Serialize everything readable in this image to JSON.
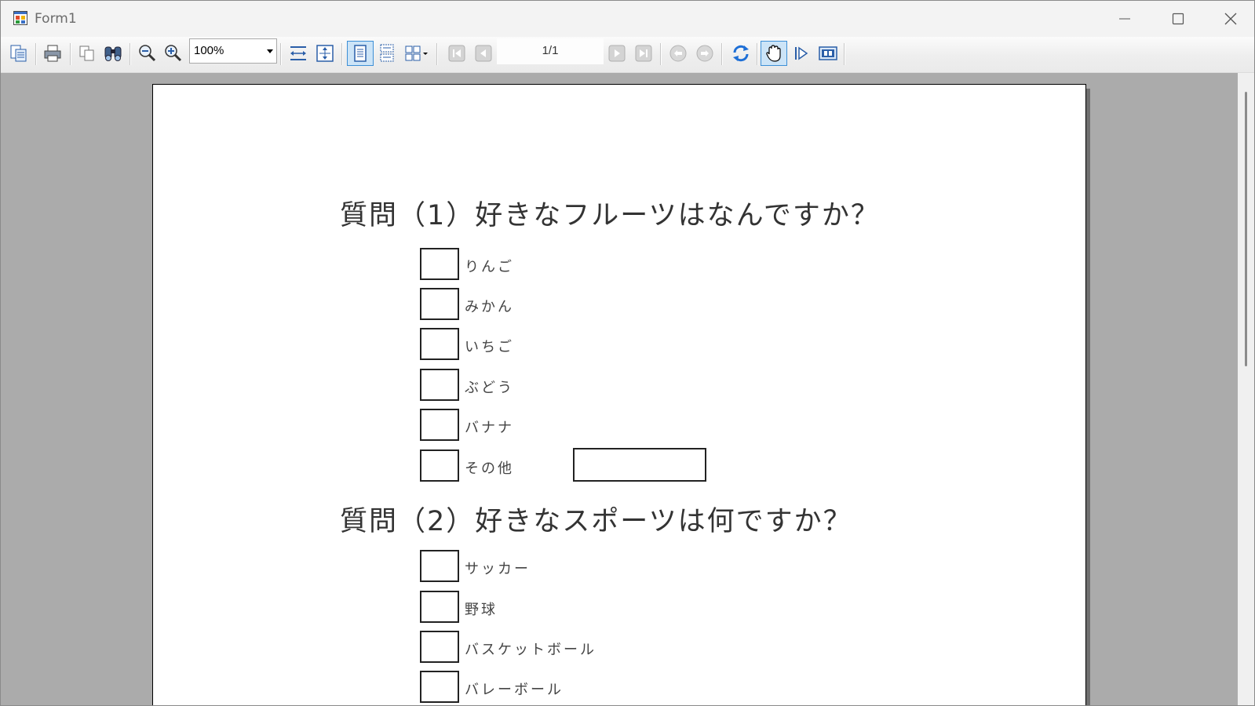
{
  "window": {
    "title": "Form1"
  },
  "toolbar": {
    "zoom_value": "100%",
    "page_indicator": "1/1"
  },
  "icons": {
    "window": [
      "app-icon",
      "minimize-icon",
      "maximize-icon",
      "close-icon"
    ],
    "toolbar": [
      "copy-pages-icon",
      "print-icon",
      "copy-icon",
      "find-icon",
      "zoom-in-icon",
      "zoom-out-icon",
      "fit-width-icon",
      "fit-page-icon",
      "single-page-icon",
      "continuous-icon",
      "multi-page-icon",
      "first-page-icon",
      "previous-page-icon",
      "next-page-icon",
      "last-page-icon",
      "back-icon",
      "forward-icon",
      "refresh-icon",
      "pan-hand-icon",
      "run-icon",
      "thumbnails-icon"
    ]
  },
  "document": {
    "question1": {
      "title": "質問（1）好きなフルーツはなんですか？",
      "options": [
        "りんご",
        "みかん",
        "いちご",
        "ぶどう",
        "バナナ",
        "その他"
      ]
    },
    "question2": {
      "title": "質問（2）好きなスポーツは何ですか？",
      "options": [
        "サッカー",
        "野球",
        "バスケットボール",
        "バレーボール"
      ]
    }
  },
  "colors": {
    "viewer_background": "#ababab",
    "paper": "#ffffff",
    "pressed_button": "#cce4f7",
    "pressed_border": "#3d8fd6",
    "refresh_icon": "#1e6fd6"
  }
}
